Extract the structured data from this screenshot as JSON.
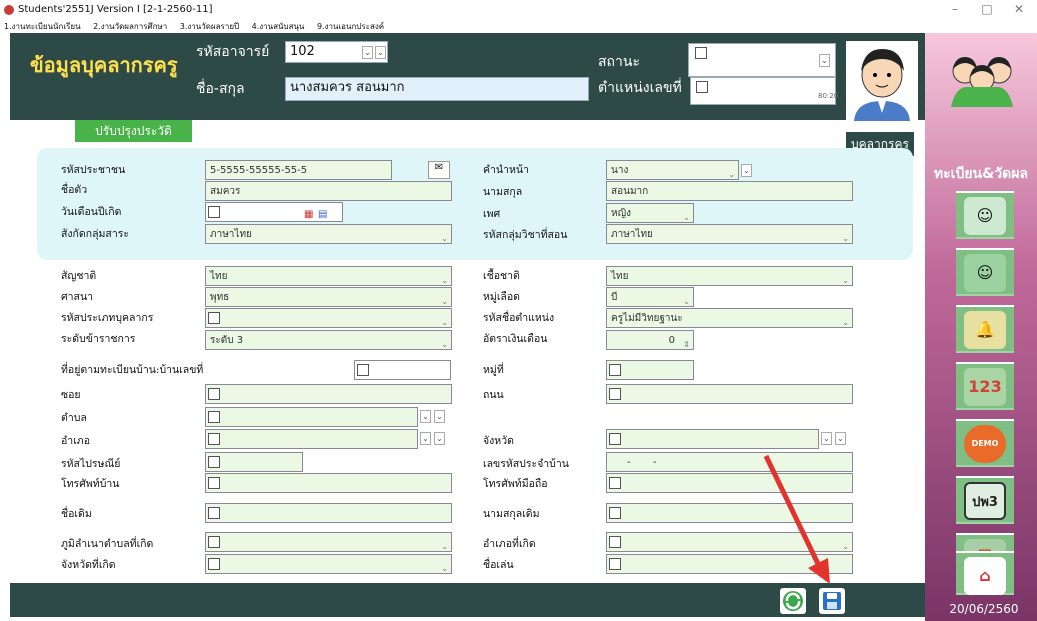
{
  "window": {
    "title": "Students'2551J Version I [2-1-2560-11]",
    "min": "–",
    "max": "□",
    "close": "✕"
  },
  "menu": [
    "1.งานทะเบียนนักเรียน",
    "2.งานวัดผลการศึกษา",
    "3.งานวัดผลรายปี",
    "4.งานสนับสนุน",
    "9.งานเอนกประสงค์"
  ],
  "header": {
    "title": "ข้อมูลบุคลากรครู",
    "teacher_code_label": "รหัสอาจารย์",
    "teacher_code": "102",
    "name_label": "ชื่อ-สกุล",
    "name": "นางสมควร  สอนมาก",
    "status_label": "สถานะ",
    "position_no_label": "ตำแหน่งเลขที่",
    "ratio": "80:20",
    "photo_label": "บุคลากรครู"
  },
  "update_button": "ปรับปรุงประวัติ",
  "form": {
    "citizen_id_label": "รหัสประชาชน",
    "citizen_id": "5-5555-55555-55-5",
    "prefix_label": "คำนำหน้า",
    "prefix": "นาง",
    "firstname_label": "ชื่อตัว",
    "firstname": "สมควร",
    "lastname_label": "นามสกุล",
    "lastname": "สอนมาก",
    "birth_label": "วันเดือนปีเกิด",
    "gender_label": "เพศ",
    "gender": "หญิง",
    "dept_label": "สังกัดกลุ่มสาระ",
    "dept": "ภาษาไทย",
    "subject_group_label": "รหัสกลุ่มวิชาที่สอน",
    "subject_group": "ภาษาไทย",
    "nationality_label": "สัญชาติ",
    "nationality": "ไทย",
    "race_label": "เชื้อชาติ",
    "race": "ไทย",
    "religion_label": "ศาสนา",
    "religion": "พุทธ",
    "blood_label": "หมู่เลือด",
    "blood": "บี",
    "staff_type_label": "รหัสประเภทบุคลากร",
    "position_label": "รหัสชื่อตำแหน่ง",
    "position": "ครูไม่มีวิทยฐานะ",
    "level_label": "ระดับข้าราชการ",
    "level": "ระดับ 3",
    "salary_label": "อัตราเงินเดือน",
    "salary": "0",
    "address_label": "ที่อยู่ตามทะเบียนบ้าน:บ้านเลขที่",
    "moo_label": "หมู่ที่",
    "soi_label": "ซอย",
    "road_label": "ถนน",
    "tambon_label": "ตำบล",
    "amphoe_label": "อำเภอ",
    "province_label": "จังหวัด",
    "postal_label": "รหัสไปรษณีย์",
    "house_id_label": "เลขรหัสประจำบ้าน",
    "house_id": "-       -",
    "home_phone_label": "โทรศัพท์บ้าน",
    "mobile_label": "โทรศัพท์มือถือ",
    "old_name_label": "ชื่อเดิม",
    "old_lastname_label": "นามสกุลเดิม",
    "birth_tambon_label": "ภูมิลำเนาตำบลที่เกิด",
    "birth_amphoe_label": "อำเภอที่เกิด",
    "birth_province_label": "จังหวัดที่เกิด",
    "nickname_label": "ชื่อเล่น"
  },
  "sidebar": {
    "title": "ทะเบียน&วัดผล",
    "date": "20/06/2560",
    "btn_123": "123",
    "btn_demo": "DEMO",
    "btn_pw3": "ปพ3"
  }
}
